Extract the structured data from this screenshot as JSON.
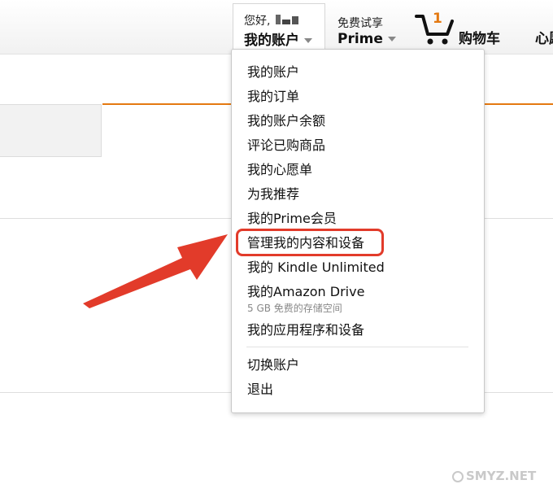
{
  "header": {
    "greeting": "您好,",
    "account_label": "我的账户",
    "prime_promo": "免费试享",
    "prime_label": "Prime",
    "cart_count": "1",
    "cart_label": "购物车",
    "wishlist_label": "心愿单"
  },
  "dropdown": {
    "items": [
      "我的账户",
      "我的订单",
      "我的账户余额",
      "评论已购商品",
      "我的心愿单",
      "为我推荐",
      "我的Prime会员",
      "管理我的内容和设备",
      "我的 Kindle Unlimited",
      "我的Amazon Drive",
      "我的应用程序和设备"
    ],
    "drive_subtitle": "5 GB 免费的存储空间",
    "footer_items": [
      "切换账户",
      "退出"
    ]
  },
  "annotation": {
    "highlighted_item": "管理我的内容和设备",
    "highlight_color": "#e23b2a"
  },
  "colors": {
    "accent": "#e47911"
  },
  "watermark": "SMYZ.NET"
}
